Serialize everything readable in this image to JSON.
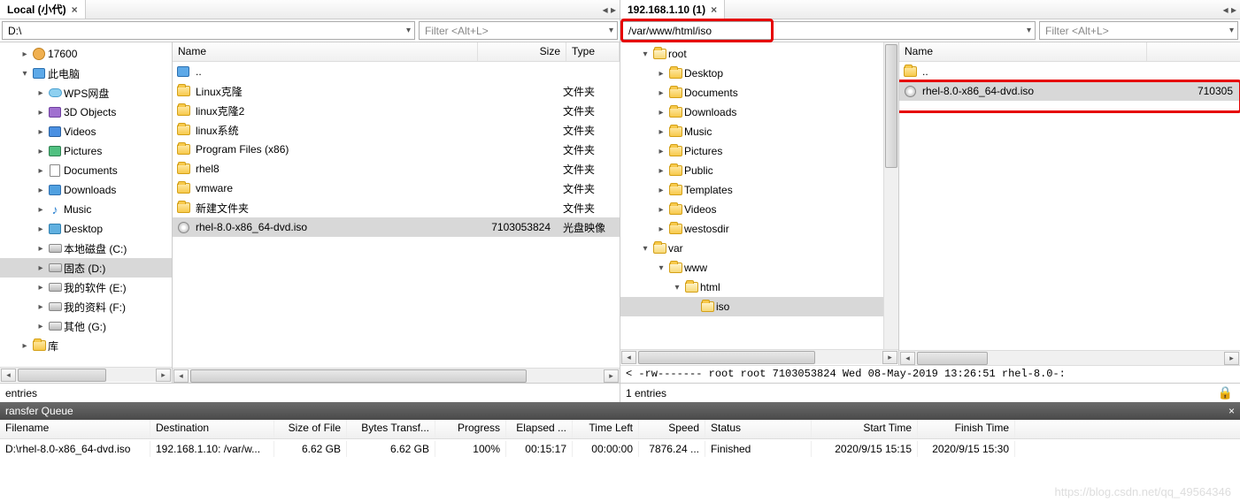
{
  "left": {
    "tab_title": "Local (小代)",
    "path": "D:\\",
    "filter_placeholder": "Filter <Alt+L>",
    "tree": [
      {
        "indent": 1,
        "tw": "▸",
        "icon": "user",
        "label": "17600"
      },
      {
        "indent": 1,
        "tw": "▾",
        "icon": "pc",
        "label": "此电脑"
      },
      {
        "indent": 2,
        "tw": "▸",
        "icon": "cloud",
        "label": "WPS网盘"
      },
      {
        "indent": 2,
        "tw": "▸",
        "icon": "obj",
        "label": "3D Objects"
      },
      {
        "indent": 2,
        "tw": "▸",
        "icon": "vid",
        "label": "Videos"
      },
      {
        "indent": 2,
        "tw": "▸",
        "icon": "pic",
        "label": "Pictures"
      },
      {
        "indent": 2,
        "tw": "▸",
        "icon": "doc",
        "label": "Documents"
      },
      {
        "indent": 2,
        "tw": "▸",
        "icon": "dl",
        "label": "Downloads"
      },
      {
        "indent": 2,
        "tw": "▸",
        "icon": "mus",
        "label": "Music"
      },
      {
        "indent": 2,
        "tw": "▸",
        "icon": "desk",
        "label": "Desktop"
      },
      {
        "indent": 2,
        "tw": "▸",
        "icon": "disk",
        "label": "本地磁盘 (C:)"
      },
      {
        "indent": 2,
        "tw": "▸",
        "icon": "disk",
        "label": "固态 (D:)",
        "sel": true
      },
      {
        "indent": 2,
        "tw": "▸",
        "icon": "disk",
        "label": "我的软件 (E:)"
      },
      {
        "indent": 2,
        "tw": "▸",
        "icon": "disk",
        "label": "我的资料 (F:)"
      },
      {
        "indent": 2,
        "tw": "▸",
        "icon": "disk",
        "label": "其他 (G:)"
      },
      {
        "indent": 1,
        "tw": "▸",
        "icon": "folder",
        "label": "库"
      }
    ],
    "list_headers": {
      "name": "Name",
      "size": "Size",
      "type": "Type"
    },
    "list": [
      {
        "icon": "pc",
        "name": "..",
        "size": "",
        "type": ""
      },
      {
        "icon": "folder",
        "name": "Linux克隆",
        "size": "",
        "type": "文件夹"
      },
      {
        "icon": "folder",
        "name": "linux克隆2",
        "size": "",
        "type": "文件夹"
      },
      {
        "icon": "folder",
        "name": "linux系统",
        "size": "",
        "type": "文件夹"
      },
      {
        "icon": "folder",
        "name": "Program Files (x86)",
        "size": "",
        "type": "文件夹"
      },
      {
        "icon": "folder",
        "name": "rhel8",
        "size": "",
        "type": "文件夹"
      },
      {
        "icon": "folder",
        "name": "vmware",
        "size": "",
        "type": "文件夹"
      },
      {
        "icon": "folder",
        "name": "新建文件夹",
        "size": "",
        "type": "文件夹"
      },
      {
        "icon": "iso",
        "name": "rhel-8.0-x86_64-dvd.iso",
        "size": "7103053824",
        "type": "光盘映像",
        "sel": true
      }
    ],
    "entries": "entries"
  },
  "right": {
    "tab_title": "192.168.1.10 (1)",
    "path": "/var/www/html/iso",
    "filter_placeholder": "Filter <Alt+L>",
    "tree": [
      {
        "indent": 1,
        "tw": "▾",
        "icon": "folder-open",
        "label": "root"
      },
      {
        "indent": 2,
        "tw": "▸",
        "icon": "folder",
        "label": "Desktop"
      },
      {
        "indent": 2,
        "tw": "▸",
        "icon": "folder",
        "label": "Documents"
      },
      {
        "indent": 2,
        "tw": "▸",
        "icon": "folder",
        "label": "Downloads"
      },
      {
        "indent": 2,
        "tw": "▸",
        "icon": "folder",
        "label": "Music"
      },
      {
        "indent": 2,
        "tw": "▸",
        "icon": "folder",
        "label": "Pictures"
      },
      {
        "indent": 2,
        "tw": "▸",
        "icon": "folder",
        "label": "Public"
      },
      {
        "indent": 2,
        "tw": "▸",
        "icon": "folder",
        "label": "Templates"
      },
      {
        "indent": 2,
        "tw": "▸",
        "icon": "folder",
        "label": "Videos"
      },
      {
        "indent": 2,
        "tw": "▸",
        "icon": "folder",
        "label": "westosdir"
      },
      {
        "indent": 1,
        "tw": "▾",
        "icon": "folder-open",
        "label": "var"
      },
      {
        "indent": 2,
        "tw": "▾",
        "icon": "folder-open",
        "label": "www"
      },
      {
        "indent": 3,
        "tw": "▾",
        "icon": "folder-open",
        "label": "html"
      },
      {
        "indent": 4,
        "tw": "",
        "icon": "folder-open",
        "label": "iso",
        "sel": true
      }
    ],
    "list_headers": {
      "name": "Name"
    },
    "list": [
      {
        "icon": "folder",
        "name": "..",
        "size": ""
      },
      {
        "icon": "iso",
        "name": "rhel-8.0-x86_64-dvd.iso",
        "size": "710305",
        "sel": true,
        "hl": true
      }
    ],
    "status": "< -rw------- root root 7103053824 Wed 08-May-2019 13:26:51 rhel-8.0-:",
    "entries": "1 entries"
  },
  "queue": {
    "title": "ransfer Queue",
    "headers": {
      "file": "Filename",
      "dest": "Destination",
      "size": "Size of File",
      "bt": "Bytes Transf...",
      "prog": "Progress",
      "el": "Elapsed ...",
      "tl": "Time Left",
      "sp": "Speed",
      "st": "Status",
      "start": "Start Time",
      "fin": "Finish Time"
    },
    "row": {
      "file": "D:\\rhel-8.0-x86_64-dvd.iso",
      "dest": "192.168.1.10: /var/w...",
      "size": "6.62 GB",
      "bt": "6.62 GB",
      "prog": "100%",
      "el": "00:15:17",
      "tl": "00:00:00",
      "sp": "7876.24 ...",
      "st": "Finished",
      "start": "2020/9/15 15:15",
      "fin": "2020/9/15 15:30"
    }
  },
  "watermark": "https://blog.csdn.net/qq_49564346"
}
